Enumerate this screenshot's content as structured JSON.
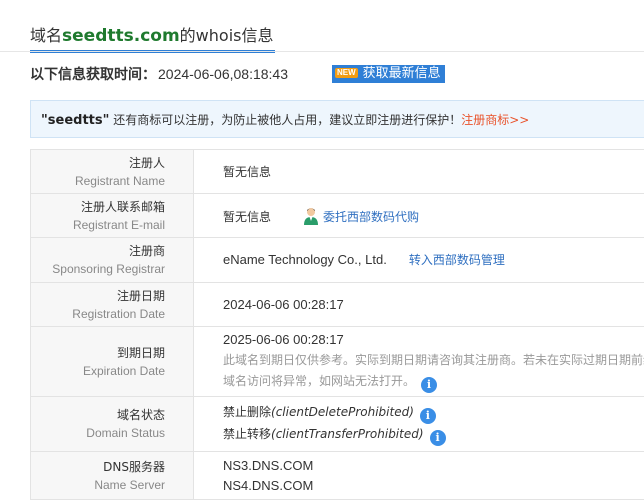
{
  "header": {
    "prefix": "域名",
    "domain": "seedtts.com",
    "suffix": "的whois信息"
  },
  "update": {
    "label": "以下信息获取时间：",
    "time": "2024-06-06,08:18:43",
    "badge": "NEW",
    "button_label": "获取最新信息"
  },
  "notice": {
    "keyword": "\"seedtts\"",
    "text": " 还有商标可以注册，为防止被他人占用，建议立即注册进行保护！",
    "link": "注册商标>>"
  },
  "rows": {
    "registrant": {
      "cn": "注册人",
      "en": "Registrant Name",
      "value": "暂无信息"
    },
    "email": {
      "cn": "注册人联系邮箱",
      "en": "Registrant E-mail",
      "value": "暂无信息",
      "link": "委托西部数码代购",
      "icon": "agent-icon"
    },
    "registrar": {
      "cn": "注册商",
      "en": "Sponsoring Registrar",
      "value": "eName Technology Co., Ltd.",
      "link": "转入西部数码管理"
    },
    "created": {
      "cn": "注册日期",
      "en": "Registration Date",
      "value": "2024-06-06 00:28:17"
    },
    "expiry": {
      "cn": "到期日期",
      "en": "Expiration Date",
      "value": "2025-06-06 00:28:17",
      "note1": "此域名到期日仅供参考。实际到期日期请咨询其注册商。若未在实际过期日期前续费",
      "note2": "域名访问将异常，如网站无法打开。"
    },
    "status": {
      "cn": "域名状态",
      "en": "Domain Status",
      "s1_cn": "禁止删除",
      "s1_en": "(clientDeleteProhibited)",
      "s2_cn": "禁止转移",
      "s2_en": "(clientTransferProhibited)"
    },
    "dns": {
      "cn": "DNS服务器",
      "en": "Name Server",
      "ns1": "NS3.DNS.COM",
      "ns2": "NS4.DNS.COM"
    }
  },
  "colors": {
    "accent": "#2f7fd6",
    "domain_green": "#1f7a2e",
    "link_orange": "#e9532b",
    "info_blue": "#3a8ee6"
  }
}
